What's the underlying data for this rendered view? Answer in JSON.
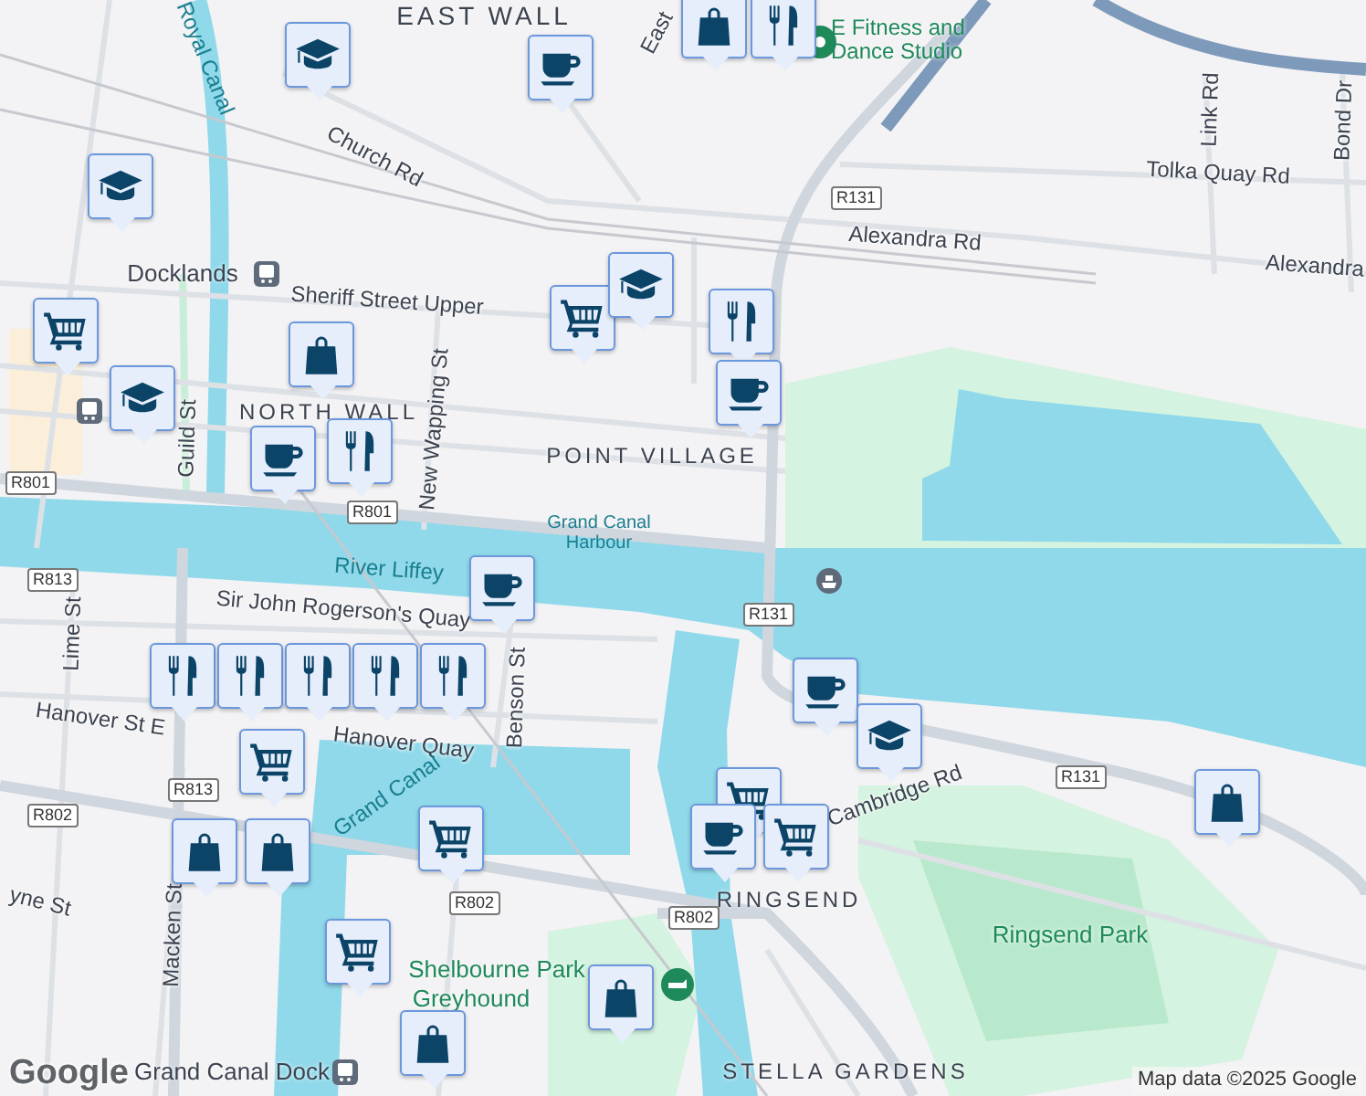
{
  "map": {
    "labels": [
      {
        "kind": "area",
        "text": "EAST WALL"
      },
      {
        "kind": "road",
        "text": "East"
      },
      {
        "kind": "water",
        "text": "Royal Canal"
      },
      {
        "kind": "road",
        "text": "Church Rd"
      },
      {
        "kind": "transit",
        "text": "Docklands"
      },
      {
        "kind": "road",
        "text": "Sheriff Street Upper"
      },
      {
        "kind": "area",
        "text": "NORTH WALL"
      },
      {
        "kind": "road",
        "text": "Guild St"
      },
      {
        "kind": "road",
        "text": "New Wapping St"
      },
      {
        "kind": "area",
        "text": "POINT VILLAGE"
      },
      {
        "kind": "water",
        "text": "Grand Canal Harbour"
      },
      {
        "kind": "water",
        "text": "River Liffey"
      },
      {
        "kind": "road",
        "text": "Sir John Rogerson's Quay"
      },
      {
        "kind": "road",
        "text": "Lime St"
      },
      {
        "kind": "road",
        "text": "Hanover St E"
      },
      {
        "kind": "road",
        "text": "Hanover Quay"
      },
      {
        "kind": "road",
        "text": "Benson St"
      },
      {
        "kind": "water",
        "text": "Grand Canal"
      },
      {
        "kind": "road",
        "text": "Macken St"
      },
      {
        "kind": "road",
        "text": "yne St"
      },
      {
        "kind": "transit",
        "text": "Grand Canal Dock"
      },
      {
        "kind": "park",
        "text": "Shelbourne Park"
      },
      {
        "kind": "park",
        "text": "Greyhound"
      },
      {
        "kind": "park",
        "text": "E Fitness and Dance Studio"
      },
      {
        "kind": "road",
        "text": "Tolka Quay Rd"
      },
      {
        "kind": "road",
        "text": "Link Rd"
      },
      {
        "kind": "road",
        "text": "Bond Dr"
      },
      {
        "kind": "road",
        "text": "Alexandra Rd"
      },
      {
        "kind": "road",
        "text": "Alexandra"
      },
      {
        "kind": "road",
        "text": "Cambridge Rd"
      },
      {
        "kind": "area",
        "text": "RINGSEND"
      },
      {
        "kind": "park",
        "text": "Ringsend Park"
      },
      {
        "kind": "area",
        "text": "STELLA GARDENS"
      }
    ],
    "shields": [
      "R801",
      "R801",
      "R813",
      "R813",
      "R802",
      "R802",
      "R802",
      "R131",
      "R131",
      "R131"
    ],
    "markers": [
      {
        "kind": "school"
      },
      {
        "kind": "cafe"
      },
      {
        "kind": "shop"
      },
      {
        "kind": "restaurant"
      },
      {
        "kind": "school"
      },
      {
        "kind": "grocery"
      },
      {
        "kind": "school"
      },
      {
        "kind": "shop"
      },
      {
        "kind": "grocery"
      },
      {
        "kind": "school"
      },
      {
        "kind": "restaurant"
      },
      {
        "kind": "cafe"
      },
      {
        "kind": "cafe"
      },
      {
        "kind": "restaurant"
      },
      {
        "kind": "cafe"
      },
      {
        "kind": "restaurant"
      },
      {
        "kind": "restaurant"
      },
      {
        "kind": "restaurant"
      },
      {
        "kind": "restaurant"
      },
      {
        "kind": "restaurant"
      },
      {
        "kind": "grocery"
      },
      {
        "kind": "shop"
      },
      {
        "kind": "shop"
      },
      {
        "kind": "grocery"
      },
      {
        "kind": "grocery"
      },
      {
        "kind": "shop"
      },
      {
        "kind": "shop"
      },
      {
        "kind": "cafe"
      },
      {
        "kind": "school"
      },
      {
        "kind": "shop"
      },
      {
        "kind": "grocery"
      },
      {
        "kind": "cafe"
      },
      {
        "kind": "grocery"
      }
    ]
  },
  "logo": "Google",
  "attribution": "Map data ©2025 Google"
}
